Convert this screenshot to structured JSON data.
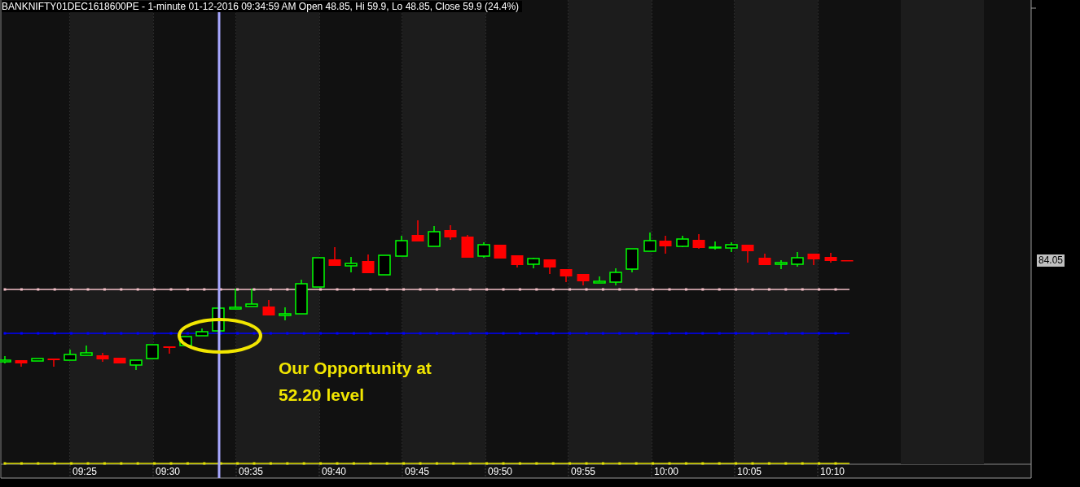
{
  "title": "BANKNIFTY01DEC1618600PE - 1-minute 01-12-2016 09:34:59 AM Open 48.85, Hi 59.9, Lo 48.85, Close 59.9 (24.4%)",
  "price_label": "84.05",
  "annotation": {
    "lines": [
      "Our Opportunity at",
      "52.20 level"
    ]
  },
  "x_axis": {
    "labels": [
      "09:25",
      "09:30",
      "09:35",
      "09:40",
      "09:45",
      "09:50",
      "09:55",
      "10:00",
      "10:05",
      "10:10"
    ]
  }
}
